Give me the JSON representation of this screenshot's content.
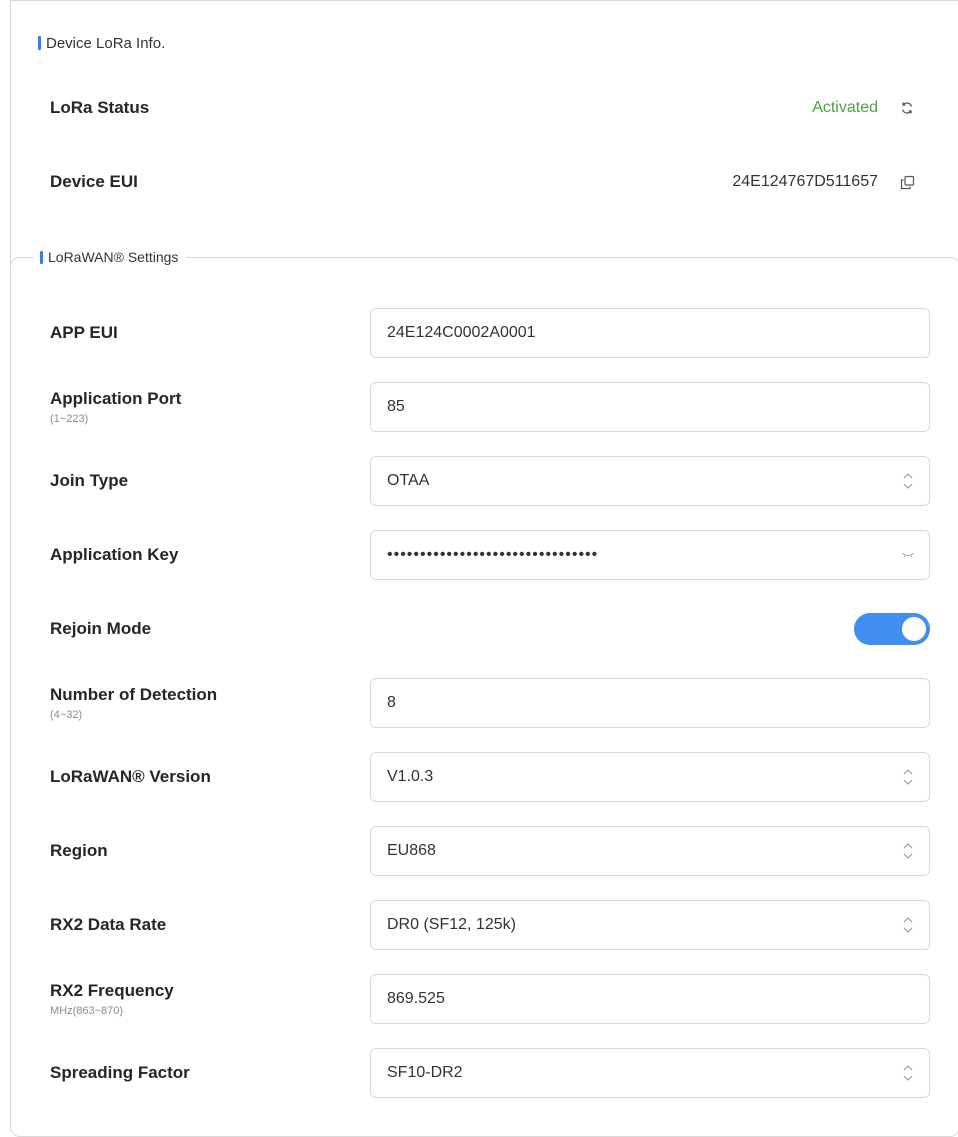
{
  "device_lora_info": {
    "title": "Device LoRa Info.",
    "lora_status": {
      "label": "LoRa Status",
      "value": "Activated",
      "status_color": "#52a244"
    },
    "device_eui": {
      "label": "Device EUI",
      "value": "24E124767D511657"
    }
  },
  "lorawan_settings": {
    "title": "LoRaWAN® Settings",
    "app_eui": {
      "label": "APP EUI",
      "value": "24E124C0002A0001"
    },
    "application_port": {
      "label": "Application Port",
      "hint": "(1~223)",
      "value": "85"
    },
    "join_type": {
      "label": "Join Type",
      "value": "OTAA"
    },
    "application_key": {
      "label": "Application Key",
      "value": "••••••••••••••••••••••••••••••••"
    },
    "rejoin_mode": {
      "label": "Rejoin Mode",
      "enabled": true
    },
    "number_of_detection": {
      "label": "Number of Detection",
      "hint": "(4~32)",
      "value": "8"
    },
    "lorawan_version": {
      "label": "LoRaWAN® Version",
      "value": "V1.0.3"
    },
    "region": {
      "label": "Region",
      "value": "EU868"
    },
    "rx2_data_rate": {
      "label": "RX2 Data Rate",
      "value": "DR0 (SF12, 125k)"
    },
    "rx2_frequency": {
      "label": "RX2 Frequency",
      "hint": "MHz(863~870)",
      "value": "869.525"
    },
    "spreading_factor": {
      "label": "Spreading Factor",
      "value": "SF10-DR2"
    }
  },
  "colors": {
    "accent": "#3f8ef0",
    "section_bar": "#2f80ed",
    "border": "#d9d9d9"
  },
  "icons": [
    "refresh-icon",
    "copy-icon",
    "select-arrows-icon",
    "eye-closed-icon"
  ]
}
